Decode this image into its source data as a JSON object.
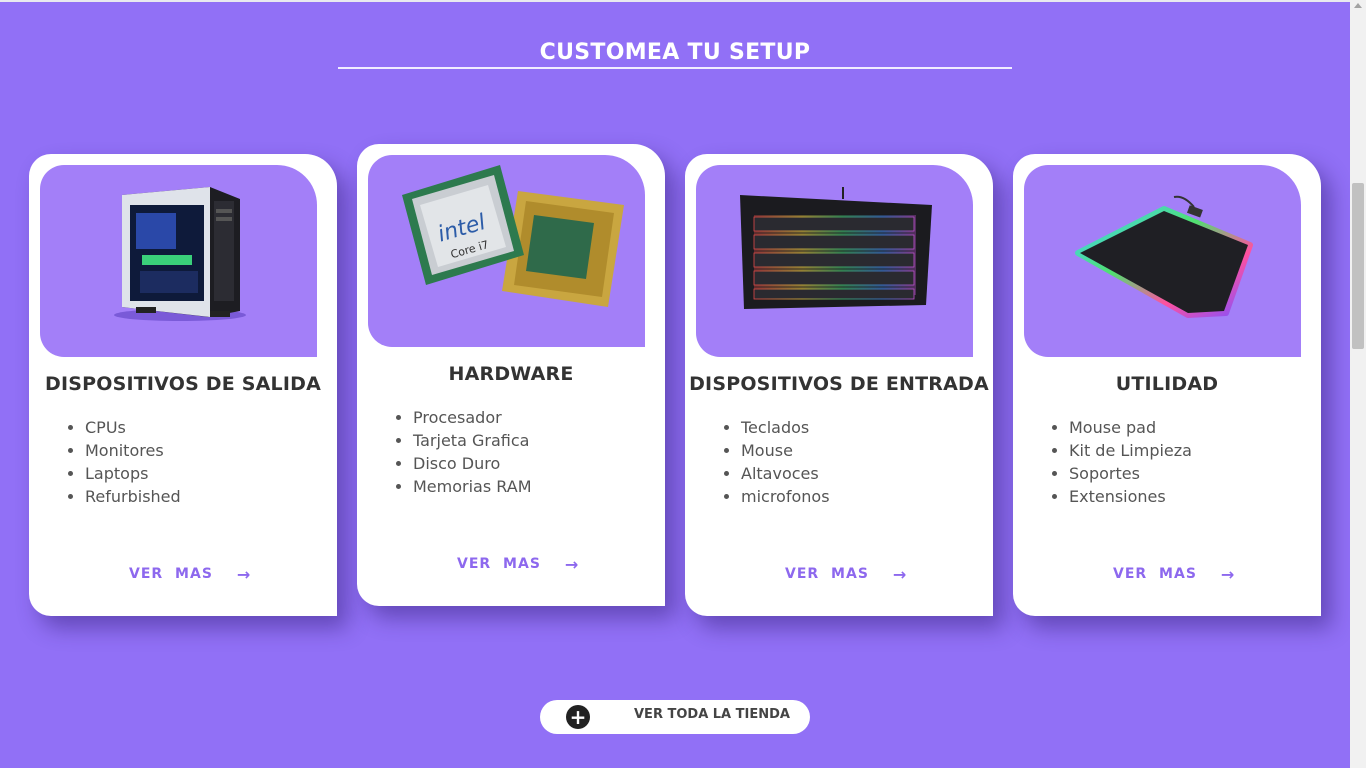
{
  "header": {
    "title": "CUSTOMEA TU SETUP"
  },
  "cards": [
    {
      "title": "DISPOSITIVOS DE SALIDA",
      "image": "gaming-pc-tower",
      "items": [
        "CPUs",
        "Monitores",
        "Laptops",
        "Refurbished"
      ],
      "link_label": "VER MAS"
    },
    {
      "title": "HARDWARE",
      "image": "intel-core-i7-processor",
      "items": [
        "Procesador",
        "Tarjeta Grafica",
        "Disco Duro",
        "Memorias RAM"
      ],
      "link_label": "VER MAS"
    },
    {
      "title": "DISPOSITIVOS DE ENTRADA",
      "image": "rgb-mechanical-keyboard",
      "items": [
        "Teclados",
        "Mouse",
        "Altavoces",
        "microfonos"
      ],
      "link_label": "VER MAS"
    },
    {
      "title": "UTILIDAD",
      "image": "rgb-mouse-pad",
      "items": [
        "Mouse pad",
        "Kit de Limpieza",
        "Soportes",
        "Extensiones"
      ],
      "link_label": "VER MAS"
    }
  ],
  "store_button": {
    "label": "VER TODA LA TIENDA",
    "icon": "plus-circle-icon"
  },
  "colors": {
    "background": "#9170f6",
    "card_image_bg": "#a37ff8",
    "link": "#8d68ee"
  }
}
